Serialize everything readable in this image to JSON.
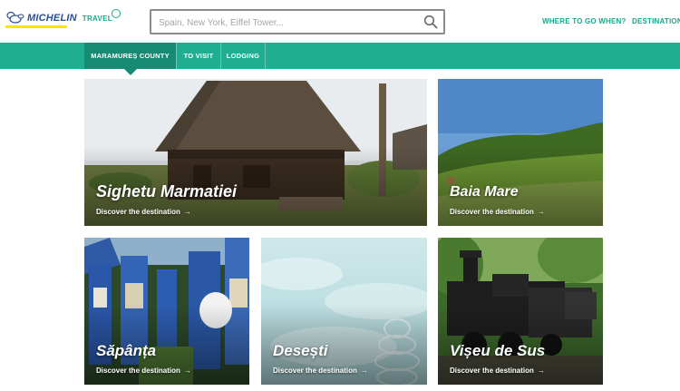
{
  "header": {
    "logo_text": "MICHELIN",
    "logo_travel": "TRAVEL",
    "search_placeholder": "Spain, New York, Eiffel Tower...",
    "nav": [
      "WHERE TO GO WHEN?",
      "DESTINATIONS"
    ]
  },
  "subnav": {
    "items": [
      "MARAMUREȘ COUNTY",
      "TO VISIT",
      "LODGING"
    ],
    "active_index": 0
  },
  "cards": [
    {
      "title": "Sighetu Marmatiei",
      "cta": "Discover the destination",
      "arrow": "→"
    },
    {
      "title": "Baia Mare",
      "cta": "Discover the destination",
      "arrow": "→"
    },
    {
      "title": "Săpânța",
      "cta": "Discover the destination",
      "arrow": "→"
    },
    {
      "title": "Desești",
      "cta": "Discover the destination",
      "arrow": "→"
    },
    {
      "title": "Vișeu de Sus",
      "cta": "Discover the destination",
      "arrow": "→"
    }
  ],
  "colors": {
    "brand_teal": "#1fae92",
    "active_teal": "#178a73",
    "michelin_blue": "#27509b",
    "michelin_yellow": "#fce500"
  }
}
